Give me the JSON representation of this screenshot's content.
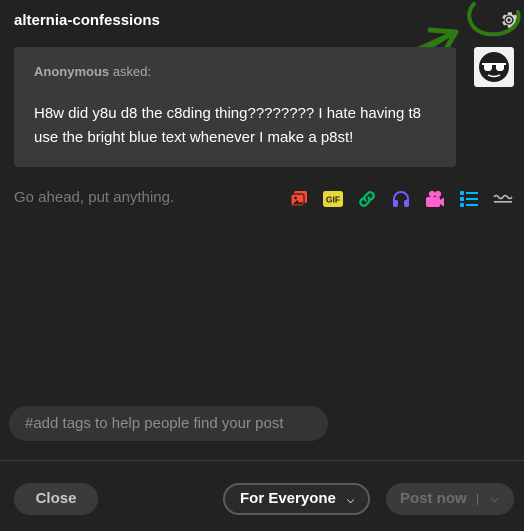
{
  "header": {
    "blog_name": "alternia-confessions"
  },
  "ask": {
    "asker": "Anonymous",
    "asked_label": "asked:",
    "question": "H8w did y8u d8 the c8ding thing???????? I hate having t8 use the bright blue text whenever I make a p8st!"
  },
  "editor": {
    "placeholder": "Go ahead, put anything."
  },
  "toolbar": {
    "tools": [
      {
        "name": "photo",
        "color": "#ff492f"
      },
      {
        "name": "gif",
        "label": "GIF",
        "color": "#e8d738"
      },
      {
        "name": "link",
        "color": "#00b86b"
      },
      {
        "name": "audio",
        "color": "#7c5cff"
      },
      {
        "name": "video",
        "color": "#ff62ce"
      },
      {
        "name": "list",
        "color": "#00b8ff"
      },
      {
        "name": "divider",
        "color": "#bdbdbd"
      }
    ]
  },
  "tags": {
    "placeholder": "#add tags to help people find your post"
  },
  "footer": {
    "close_label": "Close",
    "audience_label": "For Everyone",
    "post_label": "Post now"
  },
  "colors": {
    "background": "#222222",
    "card": "#3a3a3a",
    "annotation": "#2f7a12"
  }
}
